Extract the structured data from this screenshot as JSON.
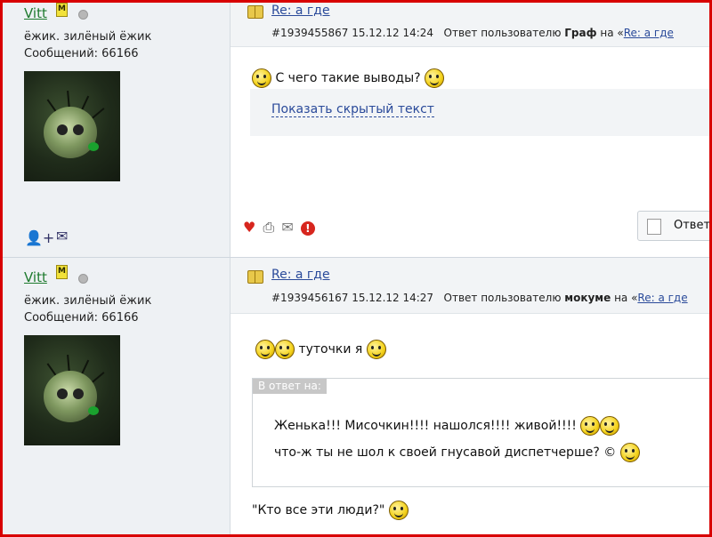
{
  "posts": [
    {
      "user": {
        "name": "Vitt",
        "badge": "M",
        "title": "ёжик. зилёный ёжик",
        "messages": "Сообщений: 66166"
      },
      "subject": "Re: а где",
      "meta": {
        "id_time": "#1939455867 15.12.12 14:24",
        "reply_prefix": "Ответ пользователю",
        "reply_user": "Граф",
        "on": "на «",
        "reply_link": "Re: а где"
      },
      "text": "С чего такие выводы?",
      "spoiler_link": "Показать скрытый текст",
      "reply_button": "Ответить"
    },
    {
      "user": {
        "name": "Vitt",
        "badge": "M",
        "title": "ёжик. зилёный ёжик",
        "messages": "Сообщений: 66166"
      },
      "subject": "Re: а где",
      "meta": {
        "id_time": "#1939456167 15.12.12 14:27",
        "reply_prefix": "Ответ пользователю",
        "reply_user": "мокуме",
        "on": "на «",
        "reply_link": "Re: а где"
      },
      "text": "туточки я",
      "quote_label": "В ответ на:",
      "quote_line1": "Женька!!! Мисочкин!!!! нашолся!!!! живой!!!!",
      "quote_line2": "что-ж ты не шол к своей гнусавой диспетчерше? ©",
      "after_quote": "\"Кто все эти люди?\""
    }
  ],
  "icons": {
    "add_friend": "add-friend-icon",
    "message": "envelope-icon",
    "like": "heart-icon",
    "print": "printer-icon",
    "email": "mail-icon",
    "report": "warning-icon"
  },
  "colors": {
    "frame": "#d80000",
    "username": "#1e7a2e",
    "link": "#2a4a9a"
  }
}
